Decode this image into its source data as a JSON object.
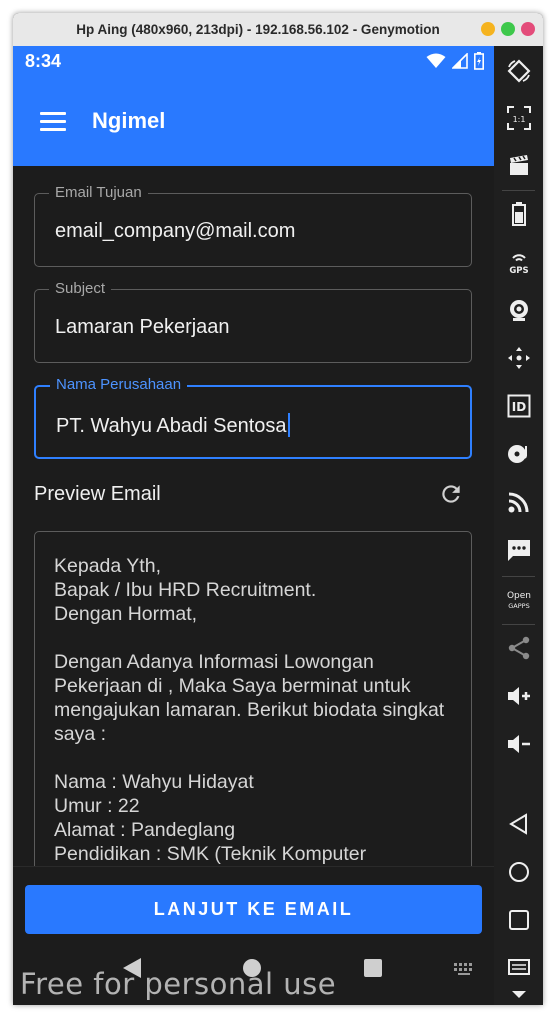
{
  "window": {
    "title": "Hp Aing (480x960, 213dpi) - 192.168.56.102 - Genymotion",
    "dot_colors": [
      "#f5b31f",
      "#3ec84b",
      "#e34c7a"
    ]
  },
  "status_bar": {
    "time": "8:34"
  },
  "app_bar": {
    "title": "Ngimel",
    "menu_icon": "hamburger-menu-icon"
  },
  "form": {
    "email": {
      "label": "Email Tujuan",
      "value": "email_company@mail.com"
    },
    "subject": {
      "label": "Subject",
      "value": "Lamaran Pekerjaan"
    },
    "company": {
      "label": "Nama Perusahaan",
      "value": "PT. Wahyu Abadi Sentosa"
    }
  },
  "preview": {
    "label": "Preview Email",
    "refresh_icon": "refresh-icon",
    "text": "Kepada Yth,\nBapak / Ibu HRD Recruitment.\nDengan Hormat,\n\nDengan Adanya Informasi Lowongan Pekerjaan di , Maka Saya berminat untuk mengajukan lamaran. Berikut biodata singkat saya :\n\nNama : Wahyu Hidayat\nUmur : 22\nAlamat : Pandeglang\nPendidikan : SMK (Teknik Komputer"
  },
  "actions": {
    "primary_label": "LANJUT KE EMAIL"
  },
  "nav": [
    "back-icon",
    "home-icon",
    "recents-icon",
    "keyboard-icon"
  ],
  "sidebar": [
    "rotate-icon",
    "pixel-perfect-icon",
    "capture-icon",
    "battery-icon",
    "gps-icon",
    "camera-icon",
    "dpad-icon",
    "device-id-icon",
    "disk-io-icon",
    "cast-icon",
    "sms-icon",
    "open-gapps-icon",
    "share-icon",
    "volume-up-icon",
    "volume-down-icon",
    "back-icon",
    "home-icon",
    "recents-icon",
    "menu-icon",
    "expand-icon"
  ],
  "sidebar_labels": {
    "gps": "GPS",
    "id": "ID",
    "gapps_1": "Open",
    "gapps_2": "GAPPS",
    "pixel": "1:1"
  },
  "watermark": "Free for personal use",
  "colors": {
    "accent": "#2979ff",
    "focus": "#2f80ff",
    "background": "#1c1c1c"
  }
}
